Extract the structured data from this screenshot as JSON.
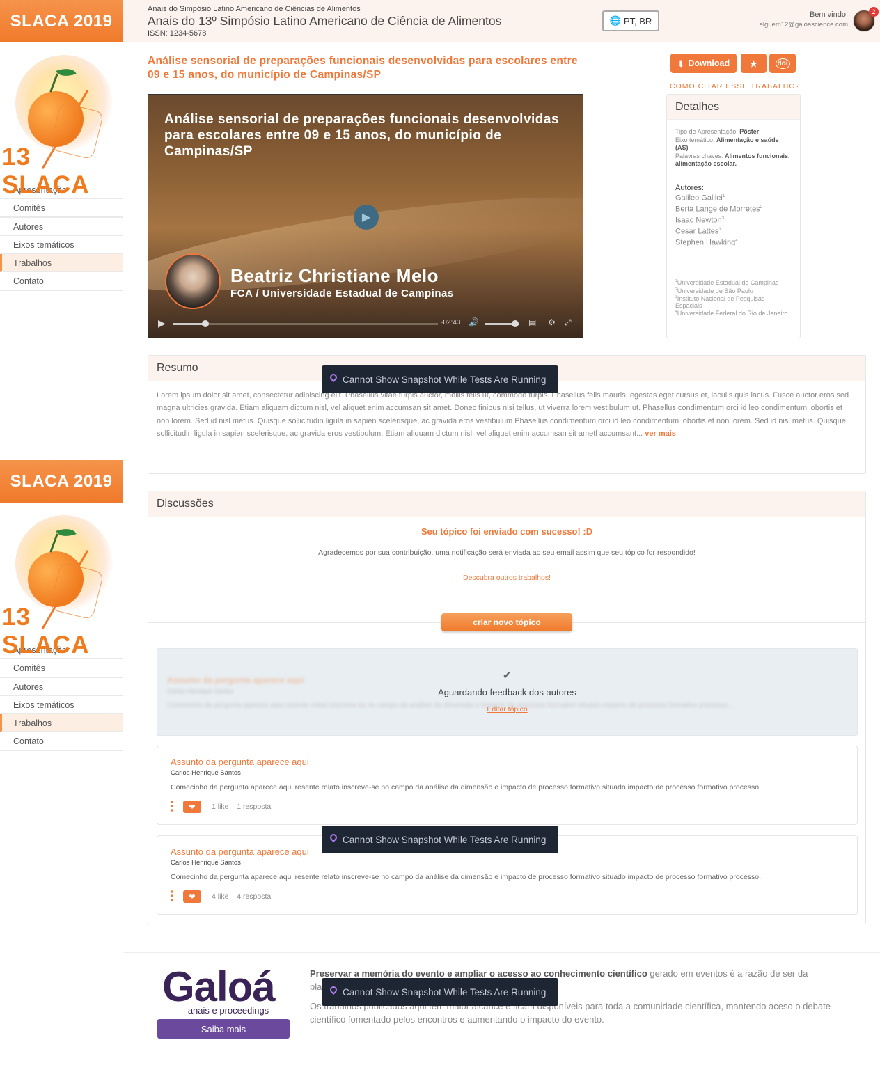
{
  "sidebar": {
    "brand": "SLACA 2019",
    "logo_text": "13 SLACA",
    "items": [
      {
        "label": "Apresentação"
      },
      {
        "label": "Comitês"
      },
      {
        "label": "Autores"
      },
      {
        "label": "Eixos temáticos"
      },
      {
        "label": "Trabalhos"
      },
      {
        "label": "Contato"
      }
    ]
  },
  "header": {
    "small_title": "Anais do Simpósio Latino Americano de Ciências de Alimentos",
    "title": "Anais do 13º Simpósio Latino Americano de Ciência de Alimentos",
    "issn": "ISSN: 1234-5678",
    "language": "PT, BR",
    "welcome": "Bem vindo!",
    "email": "alguem12@galoascience.com",
    "notifications": "2"
  },
  "paper": {
    "title": "Análise sensorial de preparações funcionais desenvolvidas para escolares entre 09 e 15 anos, do município de Campinas/SP",
    "download_label": "Download",
    "doi_label": "doi",
    "cite_label": "COMO CITAR ESSE TRABALHO?"
  },
  "video": {
    "title": "Análise sensorial de preparações funcionais desenvolvidas para escolares entre 09 e 15 anos, do município de Campinas/SP",
    "presenter": "Beatriz Christiane Melo",
    "affiliation": "FCA / Universidade Estadual de Campinas",
    "time": "-02:43",
    "progress": 0.12,
    "volume": 0.9
  },
  "details": {
    "header": "Detalhes",
    "tipo_label": "Tipo de Apresentação: ",
    "tipo_value": "Pôster",
    "eixo_label": "Eixo temático: ",
    "eixo_value": "Alimentação e saúde (AS)",
    "palavras_label": "Palavras chaves: ",
    "palavras_value": "Alimentos funcionais, alimentação escolar.",
    "authors_title": "Autores:",
    "authors": [
      {
        "name": "Galileo Galilei",
        "sup": "1"
      },
      {
        "name": "Berta Lange de Morretes",
        "sup": "2"
      },
      {
        "name": "Isaac Newton",
        "sup": "3"
      },
      {
        "name": "Cesar Lattes",
        "sup": "1"
      },
      {
        "name": "Stephen Hawking",
        "sup": "4"
      }
    ],
    "affiliations": [
      {
        "sup": "1",
        "name": "Universidade Estadual de Campinas"
      },
      {
        "sup": "2",
        "name": "Universidade de São Paulo"
      },
      {
        "sup": "3",
        "name": "Instituto Nacional de Pesquisas Espaciais"
      },
      {
        "sup": "4",
        "name": "Universidade Federal do Rio de Janeiro"
      }
    ]
  },
  "resumo": {
    "header": "Resumo",
    "text": "Lorem ipsum dolor sit amet, consectetur adipiscing elit. Phasellus vitae turpis auctor, mollis felis ut, commodo turpis. Phasellus felis mauris, egestas eget cursus et, iaculis quis lacus. Fusce auctor eros sed magna ultricies gravida. Etiam aliquam dictum nisl, vel aliquet enim accumsan sit amet. Donec finibus nisi tellus, ut viverra lorem vestibulum ut. Phasellus condimentum orci id leo condimentum lobortis et non lorem. Sed id nisl metus. Quisque sollicitudin ligula in sapien scelerisque, ac gravida eros vestibulum Phasellus condimentum orci id leo condimentum lobortis et non lorem. Sed id nisl metus. Quisque sollicitudin ligula in sapien scelerisque, ac gravida eros vestibulum. Etiam aliquam dictum nisl, vel aliquet enim accumsan sit ametl accumsant...",
    "more": "ver mais"
  },
  "tooltip": "Cannot Show Snapshot While Tests Are Running",
  "discussions": {
    "header": "Discussões",
    "success_title": "Seu tópico foi enviado com sucesso! :D",
    "success_text": "Agradecemos por sua contribuição, uma notificação será enviada ao seu email assim que seu tópico for respondido!",
    "discover_link": "Descubra outros trabalhos!",
    "new_topic": "criar novo tópico",
    "pending": {
      "subject": "Assunto da pergunta aparece aqui",
      "author": "Carlos Henrique Santos",
      "excerpt": "Comecinho da pergunta aparece aqui resente relato inscreve-se no campo da análise da dimensão e impacto de processo formativo situado impacto de processo formativo processo...",
      "status": "Aguardando feedback dos autores",
      "edit": "Editar tópico"
    },
    "topics": [
      {
        "subject": "Assunto da pergunta aparece aqui",
        "author": "Carlos Henrique Santos",
        "excerpt": "Comecinho da pergunta aparece aqui resente relato inscreve-se no campo da análise da dimensão e impacto de processo formativo situado impacto de processo formativo processo...",
        "likes": "1 like",
        "replies": "1 resposta"
      },
      {
        "subject": "Assunto da pergunta aparece aqui",
        "author": "Carlos Henrique Santos",
        "excerpt": "Comecinho da pergunta aparece aqui resente relato inscreve-se no campo da análise da dimensão e impacto de processo formativo situado impacto de processo formativo processo...",
        "likes": "4 like",
        "replies": "4 resposta"
      }
    ]
  },
  "footer": {
    "brand": "Galoá",
    "tagline": "anais e proceedings",
    "button": "Saiba mais",
    "bold_text": "Preservar a memória do evento e ampliar o acesso ao conhecimento científico",
    "text1": " gerado em eventos é a razão de ser da plataforma.",
    "text2": "Os trabalhos publicados aqui tem maior alcance e ficam disponíveis para toda a comunidade científica, mantendo aceso o debate científico fomentado pelos encontros e aumentando o impacto do evento."
  }
}
